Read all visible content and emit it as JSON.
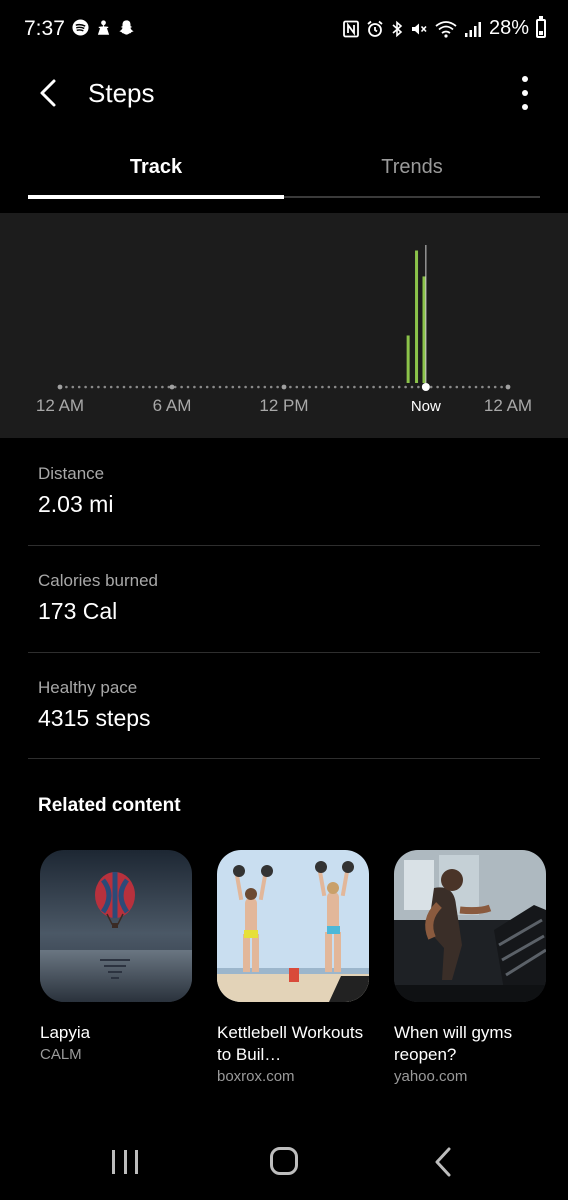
{
  "status_bar": {
    "time": "7:37",
    "battery_percent": "28%",
    "battery_level": 0.28,
    "left_icons": [
      "spotify-icon",
      "cleaner-icon",
      "snapchat-icon"
    ],
    "right_icons": [
      "nfc-icon",
      "alarm-icon",
      "bluetooth-icon",
      "mute-icon",
      "wifi-icon",
      "signal-icon",
      "battery-icon"
    ]
  },
  "header": {
    "title": "Steps",
    "back_icon": "back-arrow-icon",
    "more_icon": "more-vertical-icon"
  },
  "tabs": [
    {
      "label": "Track",
      "active": true
    },
    {
      "label": "Trends",
      "active": false
    }
  ],
  "chart_data": {
    "type": "bar",
    "x_tick_labels": [
      "12 AM",
      "6 AM",
      "12 PM",
      "Now",
      "12 AM"
    ],
    "x_range_hours": [
      0,
      24
    ],
    "now_hour": 19.6,
    "bar_color": "#8bc34a",
    "bars": [
      {
        "hour": 18.65,
        "relative_height": 0.33
      },
      {
        "hour": 19.1,
        "relative_height": 0.92
      },
      {
        "hour": 19.5,
        "relative_height": 0.74
      }
    ]
  },
  "stats": [
    {
      "label": "Distance",
      "value": "2.03 mi"
    },
    {
      "label": "Calories burned",
      "value": "173 Cal"
    },
    {
      "label": "Healthy pace",
      "value": "4315 steps"
    }
  ],
  "related": {
    "heading": "Related content",
    "items": [
      {
        "title": "Lapyia",
        "source": "CALM",
        "image": "hot-air-balloon-image"
      },
      {
        "title": "Kettlebell Workouts to Buil…",
        "source": "boxrox.com",
        "image": "kettlebell-beach-image"
      },
      {
        "title": "When will gyms reopen?",
        "source": "yahoo.com",
        "image": "treadmill-runner-image"
      }
    ]
  },
  "nav": {
    "icons": [
      "recents-icon",
      "home-icon",
      "back-icon"
    ]
  }
}
